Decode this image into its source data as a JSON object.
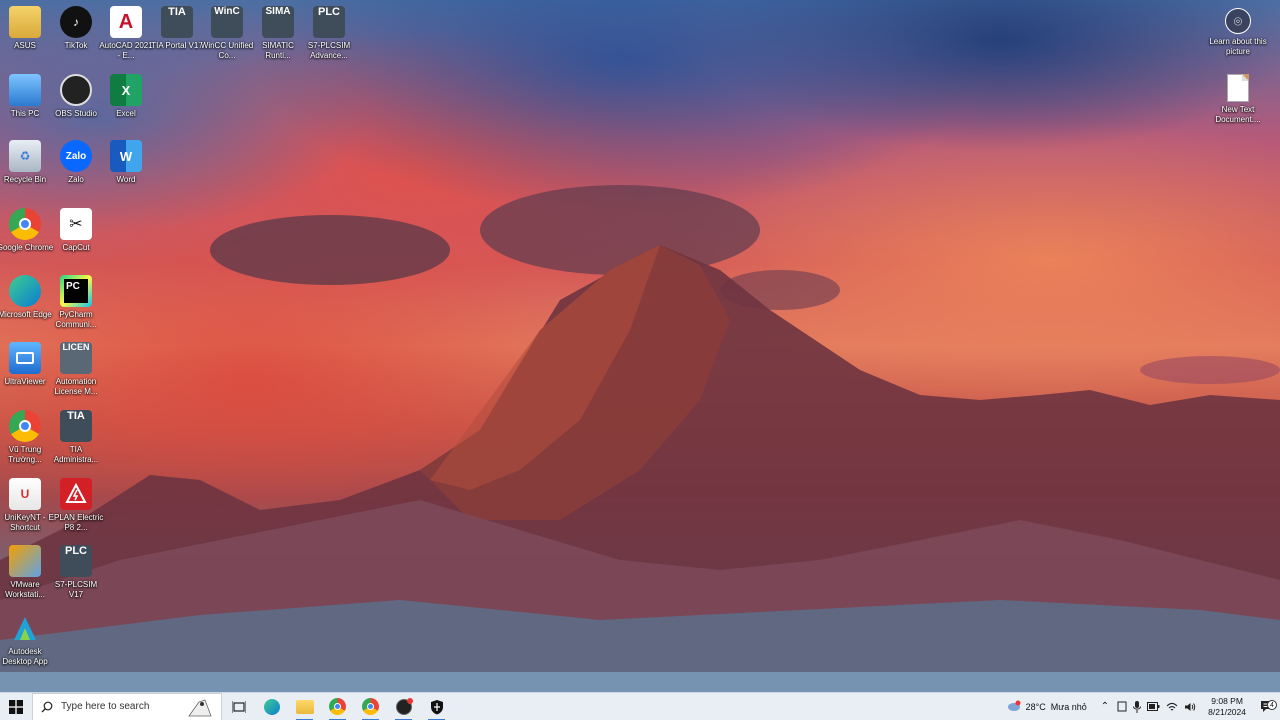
{
  "desktop": {
    "icons_col1": [
      {
        "label": "ASUS",
        "icon": "folder-icon"
      },
      {
        "label": "This PC",
        "icon": "computer-icon"
      },
      {
        "label": "Recycle Bin",
        "icon": "recycle-bin-icon"
      },
      {
        "label": "Google Chrome",
        "icon": "chrome-icon"
      },
      {
        "label": "Microsoft Edge",
        "icon": "edge-icon"
      },
      {
        "label": "UltraViewer",
        "icon": "ultraviewer-icon"
      },
      {
        "label": "Vũ Trung Trường...",
        "icon": "chrome-profile-icon"
      },
      {
        "label": "UniKeyNT - Shortcut",
        "icon": "unikey-icon"
      },
      {
        "label": "VMware Workstati...",
        "icon": "vmware-icon"
      },
      {
        "label": "Autodesk Desktop App",
        "icon": "autodesk-icon"
      }
    ],
    "icons_col2": [
      {
        "label": "TikTok",
        "icon": "tiktok-icon"
      },
      {
        "label": "OBS Studio",
        "icon": "obs-icon"
      },
      {
        "label": "Zalo",
        "icon": "zalo-icon",
        "text": "Zalo"
      },
      {
        "label": "CapCut",
        "icon": "capcut-icon"
      },
      {
        "label": "PyCharm Communi...",
        "icon": "pycharm-icon",
        "text": "PC"
      },
      {
        "label": "Automation License M...",
        "icon": "alm-icon",
        "text": "LICEN"
      },
      {
        "label": "TIA Administra...",
        "icon": "tia-admin-icon",
        "text": "TIA"
      },
      {
        "label": "EPLAN Electric P8 2...",
        "icon": "eplan-icon"
      },
      {
        "label": "S7-PLCSIM V17",
        "icon": "plcsim-icon",
        "text": "PLC"
      }
    ],
    "icons_col3": [
      {
        "label": "AutoCAD 2021 - E...",
        "icon": "autocad-icon",
        "text": "A"
      },
      {
        "label": "Excel",
        "icon": "excel-icon",
        "text": "X"
      },
      {
        "label": "Word",
        "icon": "word-icon",
        "text": "W"
      }
    ],
    "icons_top_row": [
      {
        "label": "TIA Portal V17",
        "icon": "tia-portal-icon",
        "text": "TIA"
      },
      {
        "label": "WinCC Unified Co...",
        "icon": "wincc-icon",
        "text": "WinC"
      },
      {
        "label": "SIMATIC Runti...",
        "icon": "simatic-icon",
        "text": "SIMA"
      },
      {
        "label": "S7-PLCSIM Advance...",
        "icon": "plcsim-adv-icon",
        "text": "PLC"
      }
    ],
    "right_icons": [
      {
        "label": "Learn about this picture",
        "icon": "camera-icon"
      },
      {
        "label": "New Text Document....",
        "icon": "text-file-icon"
      }
    ]
  },
  "taskbar": {
    "search_placeholder": "Type here to search",
    "weather_temp": "28°C",
    "weather_desc": "Mưa nhỏ",
    "time": "9:08 PM",
    "date": "8/21/2024",
    "notification_count": "4",
    "apps": [
      "task-view-icon",
      "edge-icon",
      "file-explorer-icon",
      "chrome-icon",
      "chrome-icon",
      "obs-icon",
      "security-icon"
    ]
  },
  "colors": {
    "taskbar_bg": "#e9eef5",
    "accent": "#3a7bd5"
  }
}
